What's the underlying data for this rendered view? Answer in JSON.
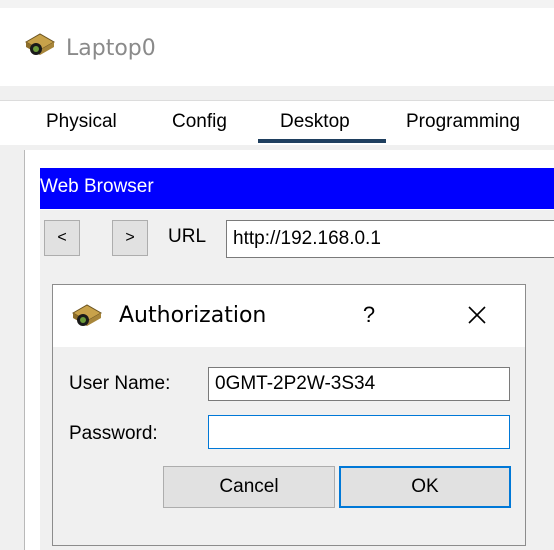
{
  "window": {
    "title": "Laptop0",
    "icon": "laptop-device-icon"
  },
  "tabs": [
    {
      "label": "Physical"
    },
    {
      "label": "Config"
    },
    {
      "label": "Desktop",
      "active": true
    },
    {
      "label": "Programming"
    }
  ],
  "browser": {
    "title": "Web Browser",
    "back_label": "<",
    "forward_label": ">",
    "url_label": "URL",
    "url_value": "http://192.168.0.1",
    "accent_color": "#0000ff"
  },
  "auth_dialog": {
    "title": "Authorization",
    "help_label": "?",
    "username_label": "User Name:",
    "username_value": "0GMT-2P2W-3S34",
    "password_label": "Password:",
    "password_value": "",
    "cancel_label": "Cancel",
    "ok_label": "OK",
    "focus_color": "#0078d7"
  }
}
